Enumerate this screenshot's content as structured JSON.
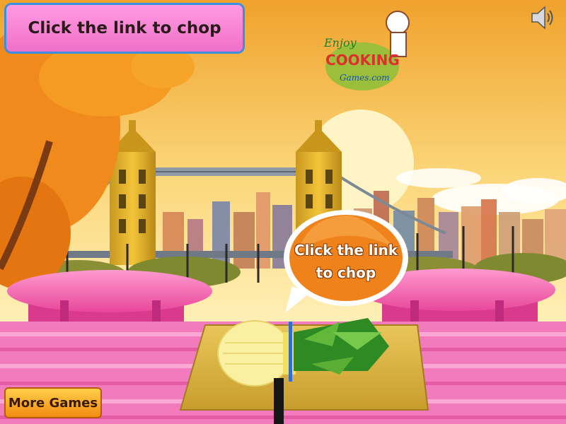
{
  "header": {
    "instruction": "Click the link to chop"
  },
  "logo": {
    "line1": "Enjoy",
    "line2": "COOKING",
    "line3": "Games.com"
  },
  "bubble": {
    "line1": "Click the link",
    "line2": "to chop"
  },
  "footer": {
    "more_games": "More Games"
  },
  "icons": {
    "sound": "speaker-icon"
  },
  "colors": {
    "pink": "#f070c8",
    "orange": "#f08a1c",
    "blue": "#3b8fe0"
  }
}
